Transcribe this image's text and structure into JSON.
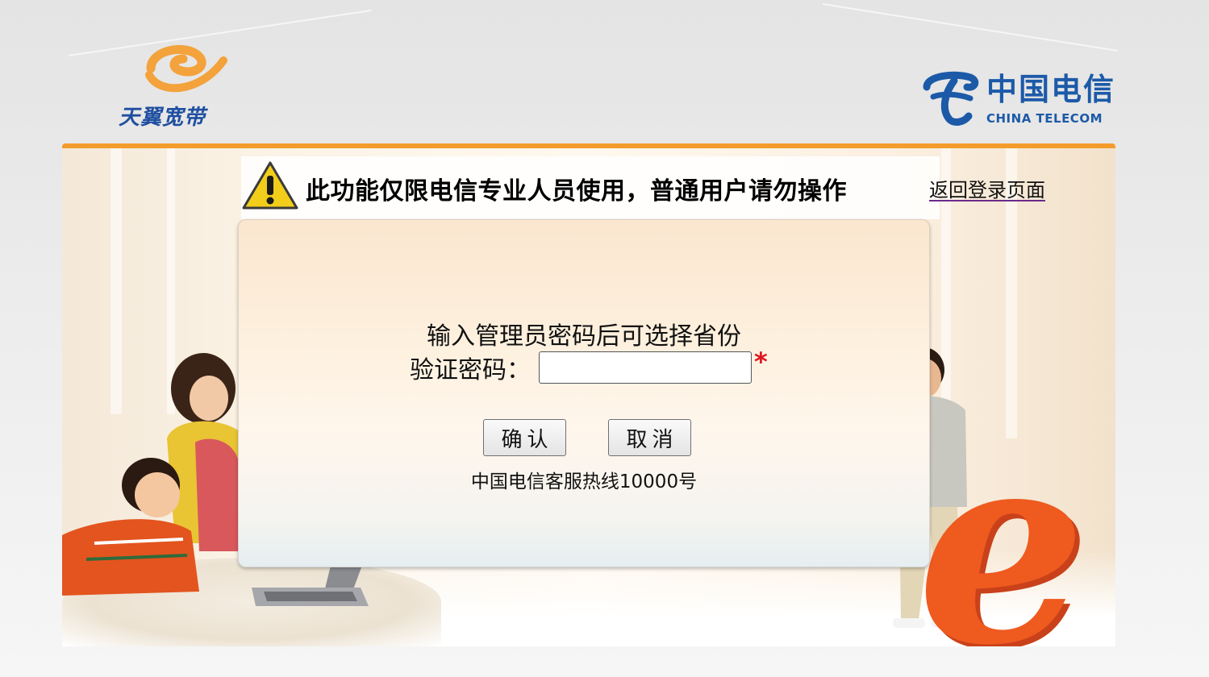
{
  "header": {
    "left_logo": {
      "text": "天翼宽带",
      "swirl_color": "#f3a23c",
      "text_color": "#1f4fa0"
    },
    "right_logo": {
      "cn": "中国电信",
      "en": "CHINA TELECOM",
      "color": "#1c5aa8"
    }
  },
  "warning": {
    "icon": "warning-triangle-icon",
    "text": "此功能仅限电信专业人员使用，普通用户请勿操作",
    "back_link": "返回登录页面"
  },
  "form": {
    "hint": "输入管理员密码后可选择省份",
    "password_label": "验证密码：",
    "password_value": "",
    "required_mark": "*",
    "confirm_label": "确认",
    "cancel_label": "取消",
    "hotline": "中国电信客服热线10000号"
  },
  "colors": {
    "accent_orange": "#f39c2b",
    "required_red": "#e0141e",
    "e_orange": "#ef5a1f"
  }
}
